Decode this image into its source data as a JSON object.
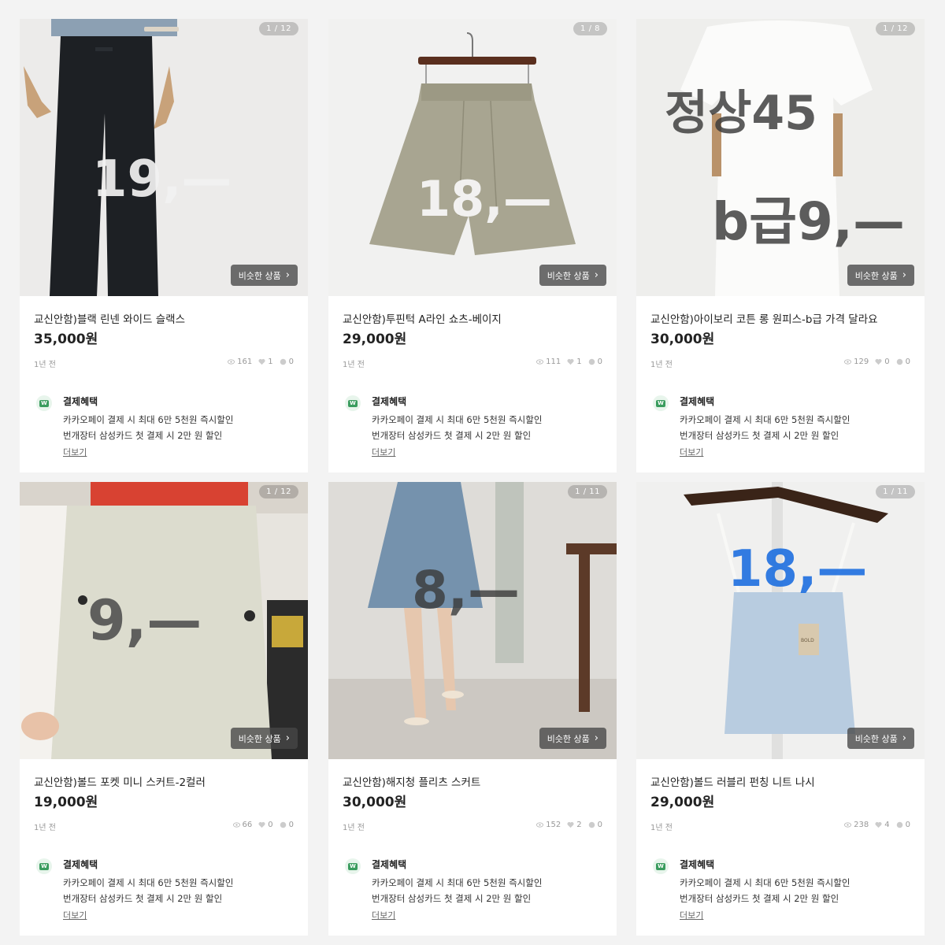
{
  "common": {
    "similar_label": "비슷한 상품",
    "benefit_title": "결제혜택",
    "benefit_line1": "카카오페이 결제 시 최대 6만 5천원 즉시할인",
    "benefit_line2": "번개장터 삼성카드 첫 결제 시 2만 원  할인",
    "more_label": "더보기",
    "logo_letter": "W"
  },
  "products": [
    {
      "counter": "1 / 12",
      "title": "교신안함)블랙 린넨 와이드 슬랙스",
      "price": "35,000원",
      "time": "1년 전",
      "views": "161",
      "likes": "1",
      "chats": "0",
      "overlay": "19,—"
    },
    {
      "counter": "1 / 8",
      "title": "교신안함)투핀턱 A라인 쇼츠-베이지",
      "price": "29,000원",
      "time": "1년 전",
      "views": "111",
      "likes": "1",
      "chats": "0",
      "overlay": "18,—"
    },
    {
      "counter": "1 / 12",
      "title": "교신안함)아이보리 코튼 롱 원피스-b급 가격 달라요",
      "price": "30,000원",
      "time": "1년 전",
      "views": "129",
      "likes": "0",
      "chats": "0",
      "overlay1": "정상45",
      "overlay2": "b급9,—"
    },
    {
      "counter": "1 / 12",
      "title": "교신안함)볼드 포켓 미니 스커트-2컬러",
      "price": "19,000원",
      "time": "1년 전",
      "views": "66",
      "likes": "0",
      "chats": "0",
      "overlay": "9,—"
    },
    {
      "counter": "1 / 11",
      "title": "교신안함)해지청 플리츠 스커트",
      "price": "30,000원",
      "time": "1년 전",
      "views": "152",
      "likes": "2",
      "chats": "0",
      "overlay": "8,—"
    },
    {
      "counter": "1 / 11",
      "title": "교신안함)볼드 러블리 펀칭 니트 나시",
      "price": "29,000원",
      "time": "1년 전",
      "views": "238",
      "likes": "4",
      "chats": "0",
      "overlay": "18,—",
      "tag": "BOLD"
    }
  ]
}
